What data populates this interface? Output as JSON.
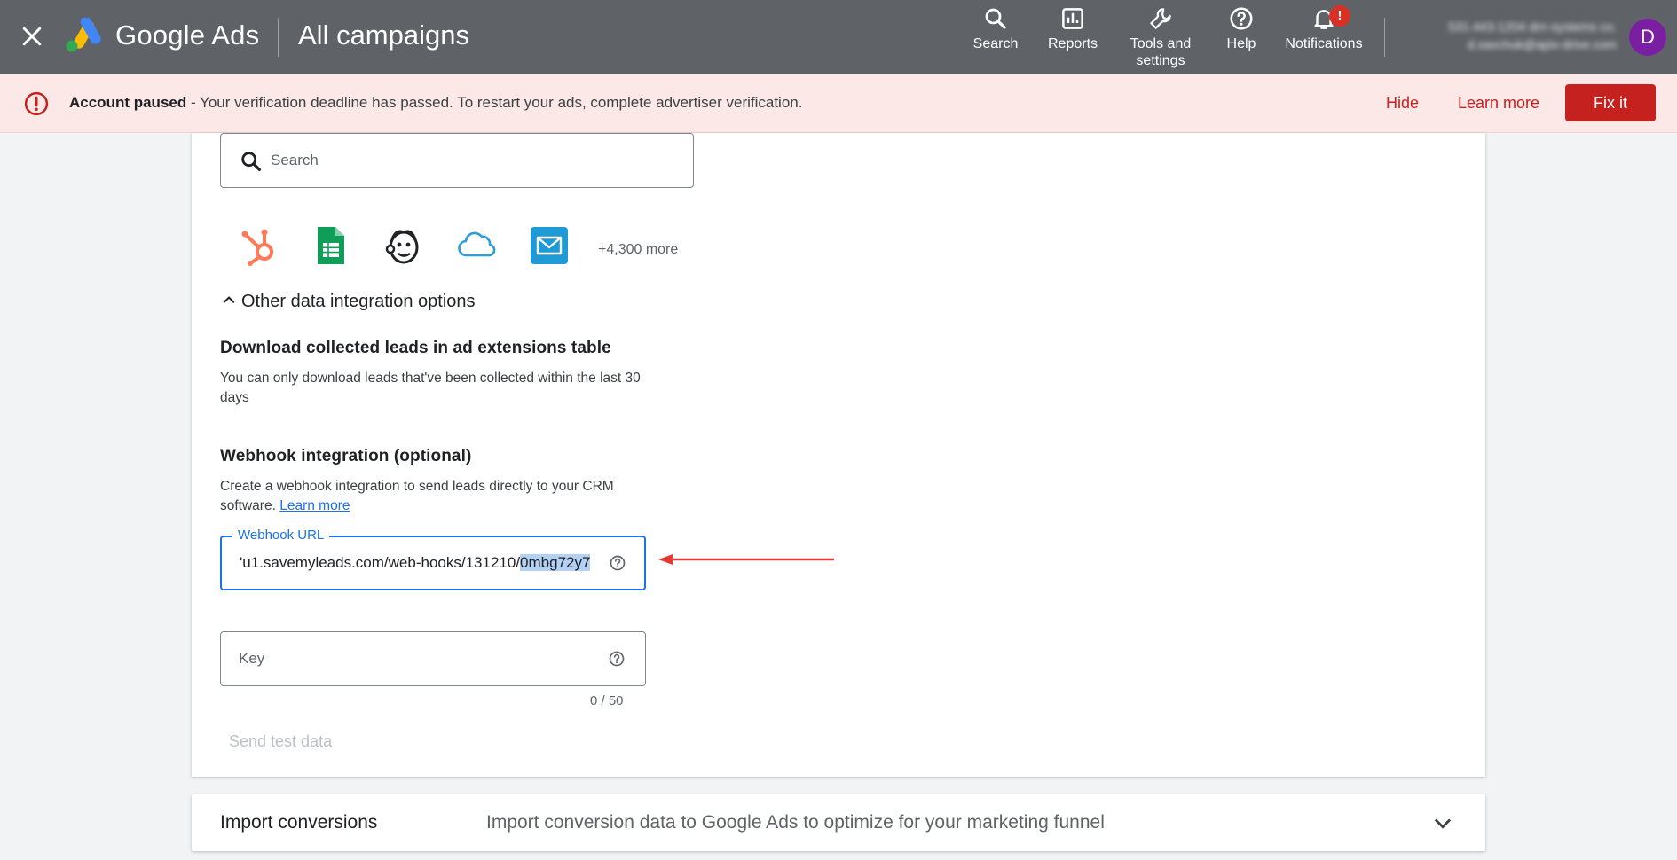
{
  "topbar": {
    "brand": "Google Ads",
    "page_title": "All campaigns",
    "nav": {
      "search": "Search",
      "reports": "Reports",
      "tools_line1": "Tools and",
      "tools_line2": "settings",
      "help": "Help",
      "notifications": "Notifications",
      "notif_badge": "!"
    },
    "account": {
      "line1": "531-443-1204 drn-systems co.",
      "line2": "d.savchuk@apix-drive.com",
      "avatar_letter": "D"
    }
  },
  "alert": {
    "bold": "Account paused",
    "message": " - Your verification deadline has passed. To restart your ads, complete advertiser verification.",
    "hide": "Hide",
    "learn_more": "Learn more",
    "fix_it": "Fix it"
  },
  "integrations": {
    "search_placeholder": "Search",
    "apps": [
      "hubspot-icon",
      "google-sheets-icon",
      "mailchimp-icon",
      "salesforce-cloud-icon",
      "email-app-icon"
    ],
    "more": "+4,300 more",
    "other_options": "Other data integration options"
  },
  "download_section": {
    "title": "Download collected leads in ad extensions table",
    "desc": "You can only download leads that've been collected within the last 30 days"
  },
  "webhook_section": {
    "title": "Webhook integration (optional)",
    "desc": "Create a webhook integration to send leads directly to your CRM software.",
    "learn_more": "Learn more",
    "url_label": "Webhook URL",
    "url_prefix": "'u1.savemyleads.com/web-hooks/131210/",
    "url_selected": "0mbg72y7",
    "key_placeholder": "Key",
    "key_counter": "0 / 50",
    "send_test": "Send test data"
  },
  "import_row": {
    "title": "Import conversions",
    "desc": "Import conversion data to Google Ads to optimize for your marketing funnel"
  },
  "colors": {
    "topbar": "#5f6368",
    "alert_bg": "#fce8e6",
    "alert_red": "#c5221f",
    "focus_blue": "#1a73e8",
    "arrow_red": "#e53935"
  }
}
